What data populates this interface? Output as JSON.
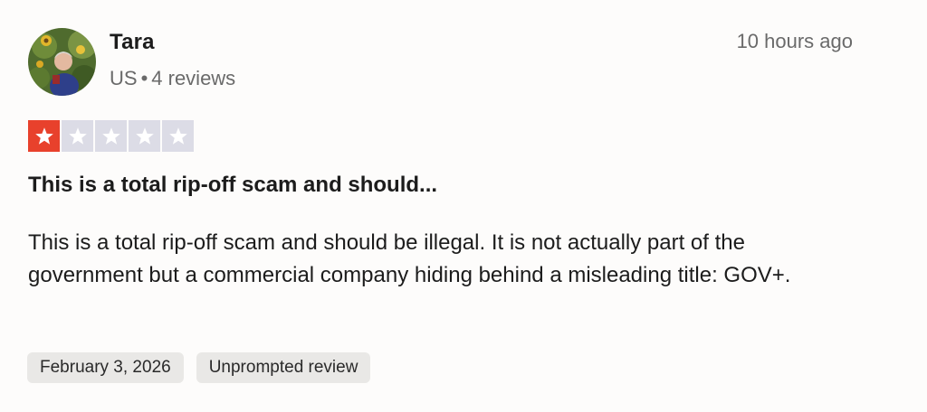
{
  "reviewer": {
    "name": "Tara",
    "country": "US",
    "separator": "•",
    "review_count": "4 reviews"
  },
  "timestamp": "10 hours ago",
  "rating": {
    "value": 1,
    "max": 5,
    "filled_color": "#e8412c",
    "empty_color": "#dcdce6",
    "star_icon": "star-icon"
  },
  "review": {
    "title": "This is a total rip-off scam and should...",
    "body": "This is a total rip-off scam and should be illegal. It is not actually part of the government but a commercial company hiding behind a misleading title: GOV+."
  },
  "tags": [
    {
      "label": "February 3, 2026"
    },
    {
      "label": "Unprompted review"
    }
  ]
}
